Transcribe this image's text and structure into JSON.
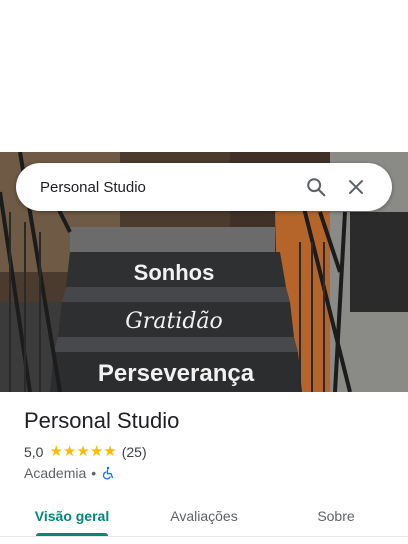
{
  "search": {
    "query": "Personal Studio"
  },
  "photo": {
    "steps_text": [
      "Sonhos",
      "Gratidão",
      "Perseverança"
    ]
  },
  "place": {
    "name": "Personal Studio",
    "rating": "5,0",
    "stars": 5,
    "review_count": "(25)",
    "category": "Academia",
    "separator": "•"
  },
  "tabs": [
    {
      "label": "Visão geral",
      "active": true
    },
    {
      "label": "Avaliações",
      "active": false
    },
    {
      "label": "Sobre",
      "active": false
    }
  ],
  "colors": {
    "star": "#fbbc04",
    "active_tab": "#00897b",
    "accessible_icon": "#1a73e8"
  },
  "icons": [
    "search-icon",
    "close-icon",
    "wheelchair-accessible-icon",
    "star-icon"
  ]
}
